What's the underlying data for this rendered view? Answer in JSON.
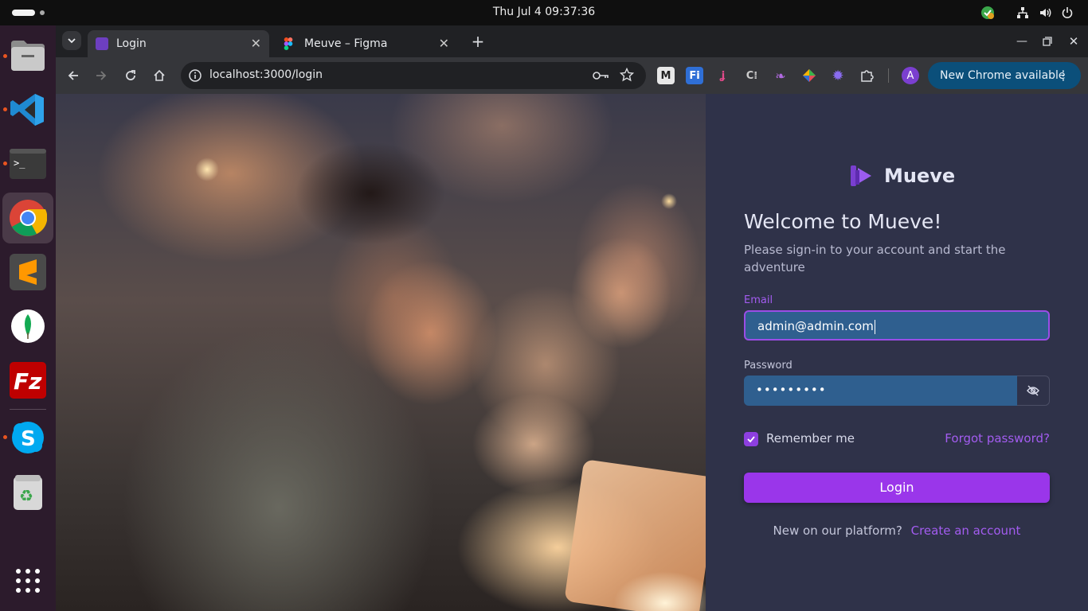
{
  "system": {
    "clock": "Thu Jul 4  09:37:36",
    "tray_icons": [
      "shield-update-icon",
      "network-icon",
      "volume-icon",
      "power-icon"
    ]
  },
  "dock": {
    "apps": [
      "files",
      "vscode",
      "terminal",
      "chrome",
      "sublime-text",
      "mongodb-compass",
      "filezilla",
      "skype",
      "trash",
      "app-grid"
    ]
  },
  "browser": {
    "tabs": [
      {
        "title": "Login",
        "favicon": "mueve-icon",
        "active": true
      },
      {
        "title": "Meuve – Figma",
        "favicon": "figma-icon",
        "active": false
      }
    ],
    "address": "localhost:3000/login",
    "profile_initial": "A",
    "update_button": "New Chrome available"
  },
  "login": {
    "brand": "Mueve",
    "welcome": "Welcome to Mueve!",
    "subtitle": "Please sign-in to your account and start the adventure",
    "email_label": "Email",
    "email_value": "admin@admin.com",
    "password_label": "Password",
    "password_value": "•••••••••",
    "remember_label": "Remember me",
    "remember_checked": true,
    "forgot_link": "Forgot password?",
    "login_button": "Login",
    "new_prompt": "New on our platform?",
    "create_link": "Create an account"
  },
  "colors": {
    "panel_bg": "#2f3249",
    "accent": "#9a36ea",
    "input_bg": "#2f5f8f"
  }
}
